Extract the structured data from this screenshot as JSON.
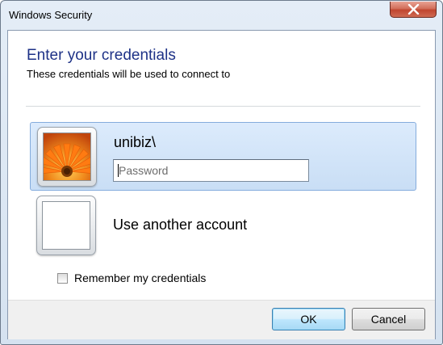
{
  "window": {
    "title": "Windows Security",
    "close_icon": "close-x-icon"
  },
  "dialog": {
    "heading": "Enter your credentials",
    "subheading": "These credentials will be used to connect to"
  },
  "accounts": [
    {
      "username": "unibiz\\",
      "password_placeholder": "Password",
      "password_value": "",
      "tile_icon": "flower-user-picture-icon",
      "selected": true
    },
    {
      "label": "Use another account",
      "tile_icon": "blank-user-tile-icon"
    }
  ],
  "remember": {
    "label": "Remember my credentials",
    "checked": false
  },
  "buttons": {
    "ok": "OK",
    "cancel": "Cancel"
  },
  "colors": {
    "heading": "#1e3287",
    "selection": "#c9def5",
    "close_button": "#c0452f"
  }
}
